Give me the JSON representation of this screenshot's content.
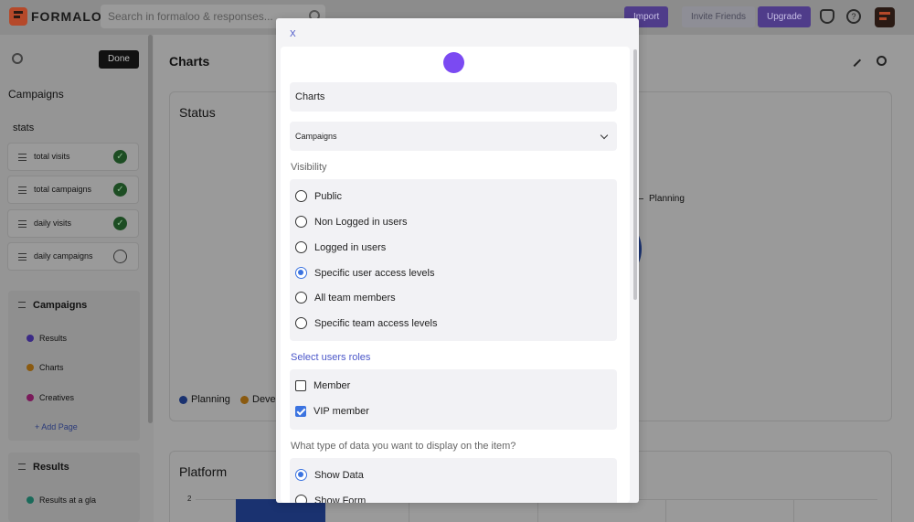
{
  "app": {
    "brand": "FORMALOO"
  },
  "topbar": {
    "search_placeholder": "Search in formaloo & responses...",
    "import_label": "Import",
    "invite_label": "Invite Friends",
    "upgrade_label": "Upgrade"
  },
  "sidebar": {
    "done_label": "Done",
    "title": "Campaigns",
    "stats_heading": "stats",
    "stats": [
      {
        "label": "total visits",
        "done": true
      },
      {
        "label": "total campaigns",
        "done": true
      },
      {
        "label": "daily visits",
        "done": true
      },
      {
        "label": "daily campaigns",
        "done": false
      }
    ],
    "groups": [
      {
        "title": "Campaigns",
        "items": [
          {
            "label": "Results",
            "color": "#3b2a86"
          },
          {
            "label": "Charts",
            "color": "#8a5a10"
          },
          {
            "label": "Creatives",
            "color": "#7a1a5a"
          }
        ],
        "add_label": "+ Add Page"
      },
      {
        "title": "Results",
        "items": [
          {
            "label": "Results at a gla",
            "color": "#1a6a5a"
          }
        ]
      }
    ]
  },
  "main": {
    "title": "Charts",
    "status_card": {
      "title": "Status",
      "legend": [
        "Planning",
        "Devel"
      ],
      "legend_colors": [
        "#1a3270",
        "#8a5a10"
      ],
      "slice_label": "Planning"
    },
    "platform_card": {
      "title": "Platform",
      "y_tick": "2"
    }
  },
  "modal": {
    "close_label": "X",
    "name_value": "Charts",
    "table_value": "Campaigns",
    "visibility_label": "Visibility",
    "visibility_options": [
      {
        "label": "Public",
        "selected": false
      },
      {
        "label": "Non Logged in users",
        "selected": false
      },
      {
        "label": "Logged in users",
        "selected": false
      },
      {
        "label": "Specific user access levels",
        "selected": true
      },
      {
        "label": "All team members",
        "selected": false
      },
      {
        "label": "Specific team access levels",
        "selected": false
      }
    ],
    "roles_label": "Select users roles",
    "roles": [
      {
        "label": "Member",
        "checked": false
      },
      {
        "label": "VIP member",
        "checked": true
      }
    ],
    "data_type_label": "What type of data you want to display on the item?",
    "data_type_options": [
      {
        "label": "Show Data",
        "selected": true
      },
      {
        "label": "Show Form",
        "selected": false
      }
    ],
    "accent_color": "#7b4af2",
    "link_color": "#4b57c9",
    "selected_color": "#3b73e0"
  }
}
